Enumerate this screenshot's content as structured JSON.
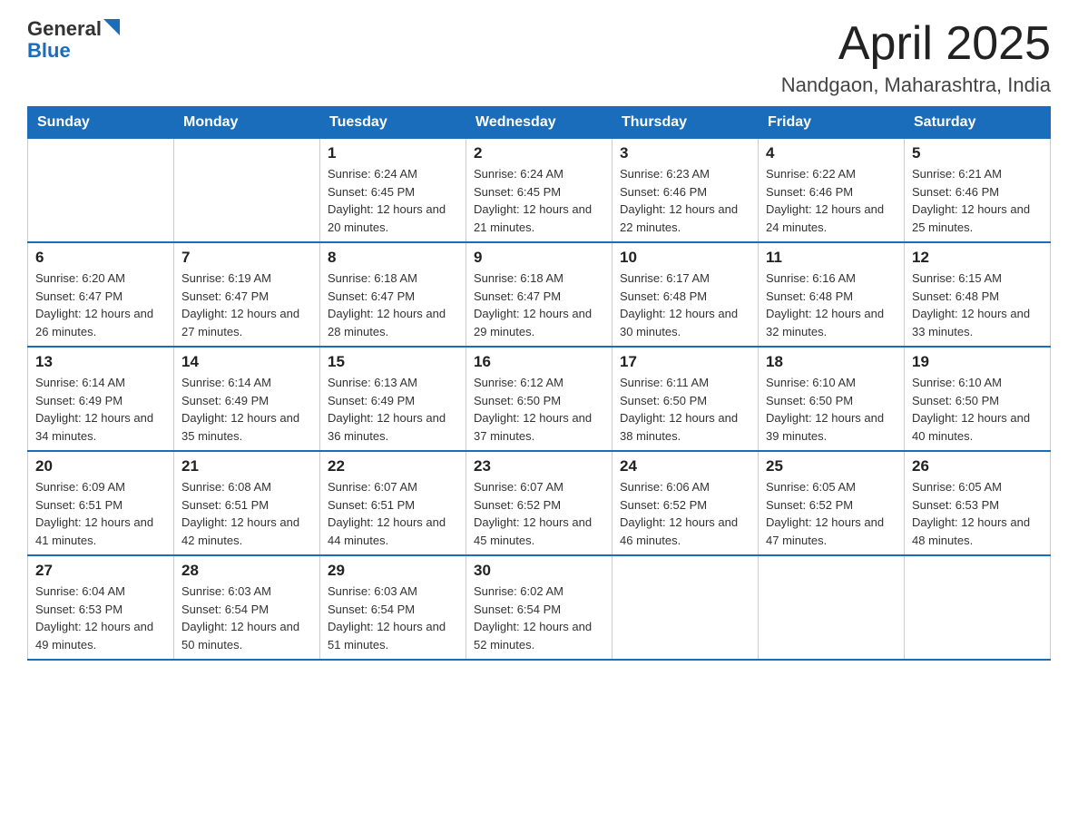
{
  "logo": {
    "text_general": "General",
    "text_blue": "Blue"
  },
  "header": {
    "month_title": "April 2025",
    "location": "Nandgaon, Maharashtra, India"
  },
  "weekdays": [
    "Sunday",
    "Monday",
    "Tuesday",
    "Wednesday",
    "Thursday",
    "Friday",
    "Saturday"
  ],
  "weeks": [
    [
      {
        "day": "",
        "sunrise": "",
        "sunset": "",
        "daylight": ""
      },
      {
        "day": "",
        "sunrise": "",
        "sunset": "",
        "daylight": ""
      },
      {
        "day": "1",
        "sunrise": "Sunrise: 6:24 AM",
        "sunset": "Sunset: 6:45 PM",
        "daylight": "Daylight: 12 hours and 20 minutes."
      },
      {
        "day": "2",
        "sunrise": "Sunrise: 6:24 AM",
        "sunset": "Sunset: 6:45 PM",
        "daylight": "Daylight: 12 hours and 21 minutes."
      },
      {
        "day": "3",
        "sunrise": "Sunrise: 6:23 AM",
        "sunset": "Sunset: 6:46 PM",
        "daylight": "Daylight: 12 hours and 22 minutes."
      },
      {
        "day": "4",
        "sunrise": "Sunrise: 6:22 AM",
        "sunset": "Sunset: 6:46 PM",
        "daylight": "Daylight: 12 hours and 24 minutes."
      },
      {
        "day": "5",
        "sunrise": "Sunrise: 6:21 AM",
        "sunset": "Sunset: 6:46 PM",
        "daylight": "Daylight: 12 hours and 25 minutes."
      }
    ],
    [
      {
        "day": "6",
        "sunrise": "Sunrise: 6:20 AM",
        "sunset": "Sunset: 6:47 PM",
        "daylight": "Daylight: 12 hours and 26 minutes."
      },
      {
        "day": "7",
        "sunrise": "Sunrise: 6:19 AM",
        "sunset": "Sunset: 6:47 PM",
        "daylight": "Daylight: 12 hours and 27 minutes."
      },
      {
        "day": "8",
        "sunrise": "Sunrise: 6:18 AM",
        "sunset": "Sunset: 6:47 PM",
        "daylight": "Daylight: 12 hours and 28 minutes."
      },
      {
        "day": "9",
        "sunrise": "Sunrise: 6:18 AM",
        "sunset": "Sunset: 6:47 PM",
        "daylight": "Daylight: 12 hours and 29 minutes."
      },
      {
        "day": "10",
        "sunrise": "Sunrise: 6:17 AM",
        "sunset": "Sunset: 6:48 PM",
        "daylight": "Daylight: 12 hours and 30 minutes."
      },
      {
        "day": "11",
        "sunrise": "Sunrise: 6:16 AM",
        "sunset": "Sunset: 6:48 PM",
        "daylight": "Daylight: 12 hours and 32 minutes."
      },
      {
        "day": "12",
        "sunrise": "Sunrise: 6:15 AM",
        "sunset": "Sunset: 6:48 PM",
        "daylight": "Daylight: 12 hours and 33 minutes."
      }
    ],
    [
      {
        "day": "13",
        "sunrise": "Sunrise: 6:14 AM",
        "sunset": "Sunset: 6:49 PM",
        "daylight": "Daylight: 12 hours and 34 minutes."
      },
      {
        "day": "14",
        "sunrise": "Sunrise: 6:14 AM",
        "sunset": "Sunset: 6:49 PM",
        "daylight": "Daylight: 12 hours and 35 minutes."
      },
      {
        "day": "15",
        "sunrise": "Sunrise: 6:13 AM",
        "sunset": "Sunset: 6:49 PM",
        "daylight": "Daylight: 12 hours and 36 minutes."
      },
      {
        "day": "16",
        "sunrise": "Sunrise: 6:12 AM",
        "sunset": "Sunset: 6:50 PM",
        "daylight": "Daylight: 12 hours and 37 minutes."
      },
      {
        "day": "17",
        "sunrise": "Sunrise: 6:11 AM",
        "sunset": "Sunset: 6:50 PM",
        "daylight": "Daylight: 12 hours and 38 minutes."
      },
      {
        "day": "18",
        "sunrise": "Sunrise: 6:10 AM",
        "sunset": "Sunset: 6:50 PM",
        "daylight": "Daylight: 12 hours and 39 minutes."
      },
      {
        "day": "19",
        "sunrise": "Sunrise: 6:10 AM",
        "sunset": "Sunset: 6:50 PM",
        "daylight": "Daylight: 12 hours and 40 minutes."
      }
    ],
    [
      {
        "day": "20",
        "sunrise": "Sunrise: 6:09 AM",
        "sunset": "Sunset: 6:51 PM",
        "daylight": "Daylight: 12 hours and 41 minutes."
      },
      {
        "day": "21",
        "sunrise": "Sunrise: 6:08 AM",
        "sunset": "Sunset: 6:51 PM",
        "daylight": "Daylight: 12 hours and 42 minutes."
      },
      {
        "day": "22",
        "sunrise": "Sunrise: 6:07 AM",
        "sunset": "Sunset: 6:51 PM",
        "daylight": "Daylight: 12 hours and 44 minutes."
      },
      {
        "day": "23",
        "sunrise": "Sunrise: 6:07 AM",
        "sunset": "Sunset: 6:52 PM",
        "daylight": "Daylight: 12 hours and 45 minutes."
      },
      {
        "day": "24",
        "sunrise": "Sunrise: 6:06 AM",
        "sunset": "Sunset: 6:52 PM",
        "daylight": "Daylight: 12 hours and 46 minutes."
      },
      {
        "day": "25",
        "sunrise": "Sunrise: 6:05 AM",
        "sunset": "Sunset: 6:52 PM",
        "daylight": "Daylight: 12 hours and 47 minutes."
      },
      {
        "day": "26",
        "sunrise": "Sunrise: 6:05 AM",
        "sunset": "Sunset: 6:53 PM",
        "daylight": "Daylight: 12 hours and 48 minutes."
      }
    ],
    [
      {
        "day": "27",
        "sunrise": "Sunrise: 6:04 AM",
        "sunset": "Sunset: 6:53 PM",
        "daylight": "Daylight: 12 hours and 49 minutes."
      },
      {
        "day": "28",
        "sunrise": "Sunrise: 6:03 AM",
        "sunset": "Sunset: 6:54 PM",
        "daylight": "Daylight: 12 hours and 50 minutes."
      },
      {
        "day": "29",
        "sunrise": "Sunrise: 6:03 AM",
        "sunset": "Sunset: 6:54 PM",
        "daylight": "Daylight: 12 hours and 51 minutes."
      },
      {
        "day": "30",
        "sunrise": "Sunrise: 6:02 AM",
        "sunset": "Sunset: 6:54 PM",
        "daylight": "Daylight: 12 hours and 52 minutes."
      },
      {
        "day": "",
        "sunrise": "",
        "sunset": "",
        "daylight": ""
      },
      {
        "day": "",
        "sunrise": "",
        "sunset": "",
        "daylight": ""
      },
      {
        "day": "",
        "sunrise": "",
        "sunset": "",
        "daylight": ""
      }
    ]
  ]
}
